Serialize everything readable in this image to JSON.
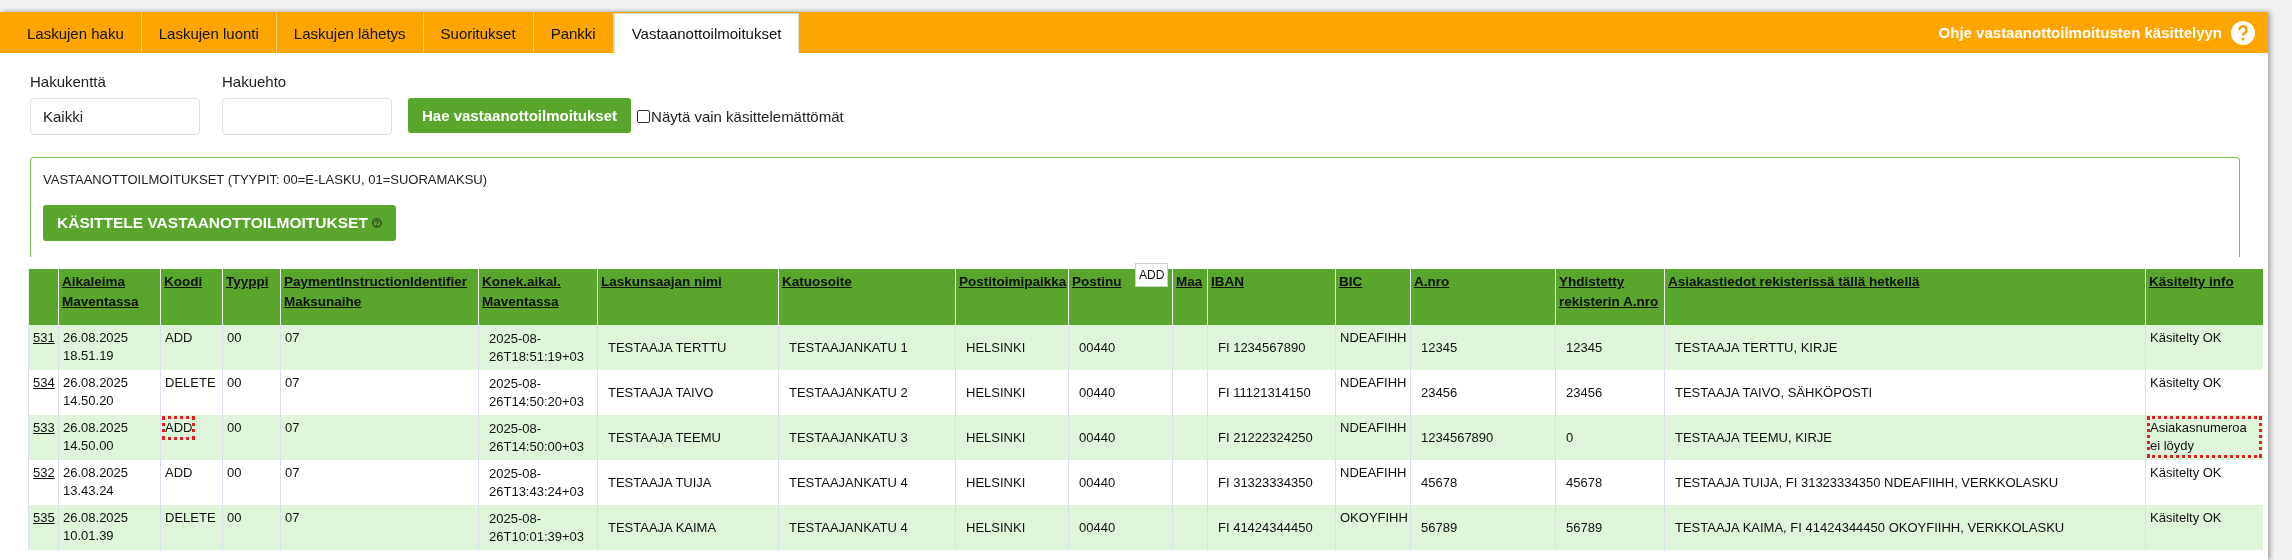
{
  "tabs": [
    {
      "label": "Laskujen haku",
      "selected": false
    },
    {
      "label": "Laskujen luonti",
      "selected": false
    },
    {
      "label": "Laskujen lähetys",
      "selected": false
    },
    {
      "label": "Suoritukset",
      "selected": false
    },
    {
      "label": "Pankki",
      "selected": false
    },
    {
      "label": "Vastaanottoilmoitukset",
      "selected": true
    }
  ],
  "help_link": "Ohje vastaanottoilmoitusten käsittelyyn",
  "search": {
    "field_label": "Hakukenttä",
    "field_value": "Kaikki",
    "term_label": "Hakuehto",
    "button": "Hae vastaanottoilmoitukset",
    "checkbox_label": "Näytä vain käsittelemättömät",
    "checkbox_checked": false
  },
  "panel": {
    "title": "VASTAANOTTOILMOITUKSET (TYYPIT: 00=E-LASKU, 01=SUORAMAKSU)",
    "button": "KÄSITTELE VASTAANOTTOILMOITUKSET"
  },
  "tooltip": "ADD",
  "table": {
    "columns": [
      "",
      "Aikaleima Maventassa",
      "Koodi",
      "Tyyppi",
      "PaymentInstructionIdentifier Maksunaihe",
      "Konek.aikal. Maventassa",
      "Laskunsaajan nimi",
      "Katuosoite",
      "Postitoimipaikka",
      "Postinu",
      "Maa",
      "IBAN",
      "BIC",
      "A.nro",
      "Yhdistetty rekisterin A.nro",
      "Asiakastiedot rekisterissä tällä hetkellä",
      "Käsitelty info"
    ],
    "rows": [
      {
        "cells": [
          "531",
          "26.08.2025 18.51.19",
          "ADD",
          "00",
          "07",
          "2025-08-26T18:51:19+03",
          "TESTAAJA TERTTU",
          "TESTAAJANKATU 1",
          "HELSINKI",
          "00440",
          "",
          "FI 1234567890",
          "NDEAFIHH",
          "12345",
          "12345",
          "TESTAAJA TERTTU, KIRJE",
          "Käsitelty OK"
        ],
        "highlights": {
          "code": false,
          "info": false
        }
      },
      {
        "cells": [
          "534",
          "26.08.2025 14.50.20",
          "DELETE",
          "00",
          "07",
          "2025-08-26T14:50:20+03",
          "TESTAAJA TAIVO",
          "TESTAAJANKATU 2",
          "HELSINKI",
          "00440",
          "",
          "FI 11121314150",
          "NDEAFIHH",
          "23456",
          "23456",
          "TESTAAJA TAIVO, SÄHKÖPOSTI",
          "Käsitelty OK"
        ],
        "highlights": {
          "code": false,
          "info": false
        }
      },
      {
        "cells": [
          "533",
          "26.08.2025 14.50.00",
          "ADD",
          "00",
          "07",
          "2025-08-26T14:50:00+03",
          "TESTAAJA TEEMU",
          "TESTAAJANKATU 3",
          "HELSINKI",
          "00440",
          "",
          "FI 21222324250",
          "NDEAFIHH",
          "1234567890",
          "0",
          "TESTAAJA TEEMU, KIRJE",
          "Asiakasnumeroa ei löydy"
        ],
        "highlights": {
          "code": true,
          "info": true
        }
      },
      {
        "cells": [
          "532",
          "26.08.2025 13.43.24",
          "ADD",
          "00",
          "07",
          "2025-08-26T13:43:24+03",
          "TESTAAJA TUIJA",
          "TESTAAJANKATU 4",
          "HELSINKI",
          "00440",
          "",
          "FI 31323334350",
          "NDEAFIHH",
          "45678",
          "45678",
          "TESTAAJA TUIJA, FI 31323334350 NDEAFIIHH, VERKKOLASKU",
          "Käsitelty OK"
        ],
        "highlights": {
          "code": false,
          "info": false
        }
      },
      {
        "cells": [
          "535",
          "26.08.2025 10.01.39",
          "DELETE",
          "00",
          "07",
          "2025-08-26T10:01:39+03",
          "TESTAAJA KAIMA",
          "TESTAAJANKATU 4",
          "HELSINKI",
          "00440",
          "",
          "FI 41424344450",
          "OKOYFIHH",
          "56789",
          "56789",
          "TESTAAJA KAIMA, FI 41424344450 OKOYFIIHH, VERKKOLASKU",
          "Käsitelty OK"
        ],
        "highlights": {
          "code": false,
          "info": false
        }
      }
    ]
  }
}
